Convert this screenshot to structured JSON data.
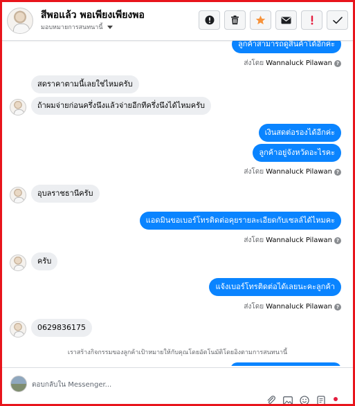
{
  "header": {
    "title": "สีพอแล้ว พอเพียงเพียงพอ",
    "assign_label": "มอบหมายการสนทนานี้"
  },
  "messages": {
    "top_partial": "ลูกค้าสามารถดูสินค้าได้อีกค่ะ",
    "in_1": "สดราคาตามนี้เลยใช่ไหมครับ",
    "in_2": "ถ้าผมจ่ายก่อนครึ่งนึงแล้วจ่ายอีกทีครึ่งนึงได้ไหมครับ",
    "out_1": "เงินสดต่อรองได้อีกค่ะ",
    "out_2": "ลูกค้าอยู่จังหวัดอะไรคะ",
    "in_3": "อุบลราชธานีครับ",
    "out_3": "แอดมินขอเบอร์โทรติดต่อคุยรายละเอียดกับเซลล์ได้ไหมคะ",
    "in_4": "ครับ",
    "out_4": "แจ้งเบอร์โทรติดต่อได้เลยนะคะลูกค้า",
    "in_5": "0629836175"
  },
  "sent_by": {
    "prefix": "ส่งโดย",
    "name": "Wannaluck Pilawan",
    "help": "?"
  },
  "notice": "เราสร้างกิจกรรมของลูกค้าเป้าหมายให้กับคุณโดยอัตโนมัติโดยอิงตามการสนทนานี้",
  "composer": {
    "placeholder": "ตอบกลับใน Messenger..."
  },
  "icons": {
    "report": "exclamation-circle-icon",
    "delete": "trash-icon",
    "star": "star-icon",
    "email": "envelope-icon",
    "spam": "exclamation-icon",
    "done": "check-icon",
    "accent_star": "#f7923a",
    "accent_red": "#e41e3f",
    "bubble_blue": "#0a84ff"
  }
}
